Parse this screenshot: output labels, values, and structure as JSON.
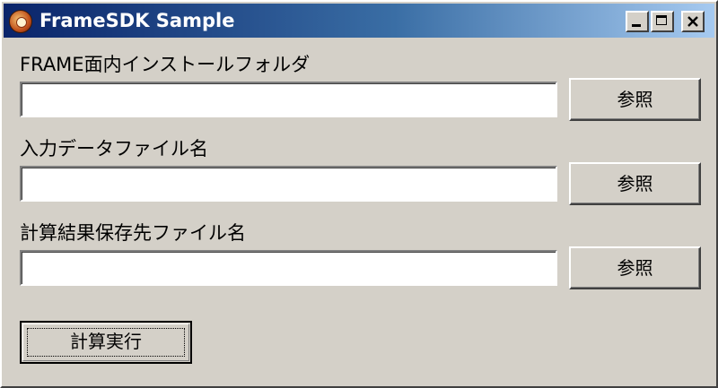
{
  "window": {
    "title": "FrameSDK Sample"
  },
  "fields": [
    {
      "label": "FRAME面内インストールフォルダ",
      "value": "",
      "browse_label": "参照"
    },
    {
      "label": "入力データファイル名",
      "value": "",
      "browse_label": "参照"
    },
    {
      "label": "計算結果保存先ファイル名",
      "value": "",
      "browse_label": "参照"
    }
  ],
  "run_button": {
    "label": "計算実行"
  }
}
